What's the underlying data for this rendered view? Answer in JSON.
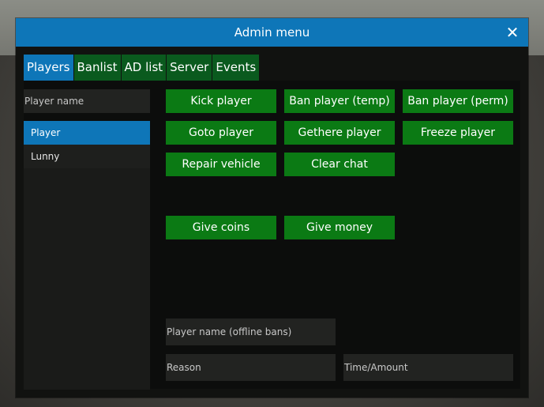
{
  "window": {
    "title": "Admin menu",
    "close_glyph": "✕"
  },
  "tabs": [
    {
      "label": "Players",
      "active": true
    },
    {
      "label": "Banlist",
      "active": false
    },
    {
      "label": "AD list",
      "active": false
    },
    {
      "label": "Server",
      "active": false
    },
    {
      "label": "Events",
      "active": false
    }
  ],
  "player_search": {
    "placeholder": "Player name"
  },
  "players": [
    {
      "name": "Player",
      "selected": true
    },
    {
      "name": "Lunny",
      "selected": false
    }
  ],
  "actions": {
    "kick": "Kick player",
    "ban_temp": "Ban player (temp)",
    "ban_perm": "Ban player (perm)",
    "goto": "Goto player",
    "gethere": "Gethere player",
    "freeze": "Freeze player",
    "repair": "Repair vehicle",
    "clear_chat": "Clear chat",
    "give_coins": "Give coins",
    "give_money": "Give money"
  },
  "fields": {
    "offline_name": "Player name (offline bans)",
    "reason": "Reason",
    "time_amount": "Time/Amount"
  },
  "colors": {
    "titlebar": "#0e76b8",
    "tab": "#0a5a1e",
    "button": "#0b7a14",
    "selected": "#0e76b8"
  }
}
